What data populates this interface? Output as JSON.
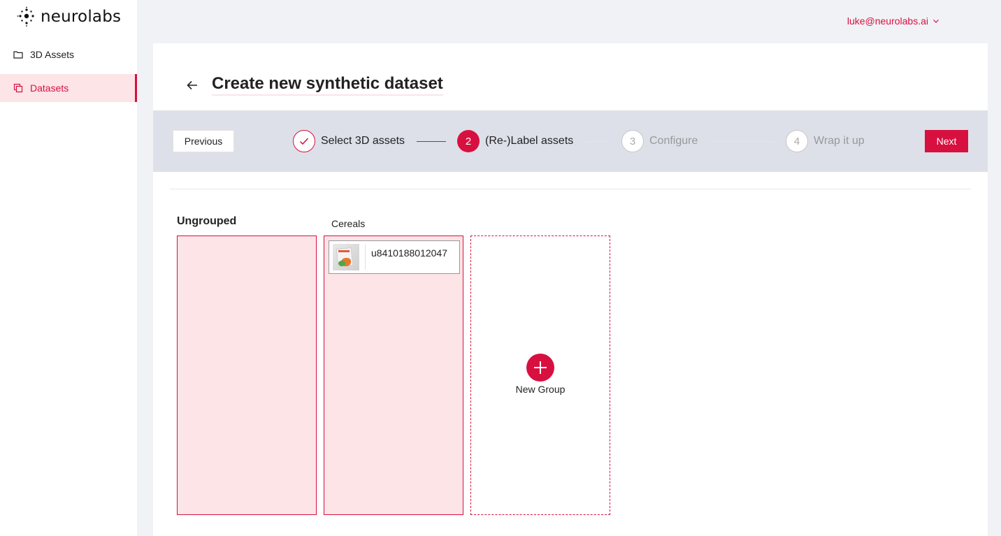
{
  "brand": {
    "name": "neurolabs",
    "accent": "#d8103f"
  },
  "sidebar": {
    "items": [
      {
        "label": "3D Assets",
        "icon": "folder-icon",
        "active": false
      },
      {
        "label": "Datasets",
        "icon": "copy-icon",
        "active": true
      }
    ]
  },
  "header": {
    "user_email": "luke@neurolabs.ai"
  },
  "page": {
    "title": "Create new synthetic dataset"
  },
  "stepper": {
    "previous_label": "Previous",
    "next_label": "Next",
    "steps": [
      {
        "number": "",
        "label": "Select 3D assets",
        "state": "done"
      },
      {
        "number": "2",
        "label": "(Re-)Label assets",
        "state": "current"
      },
      {
        "number": "3",
        "label": "Configure",
        "state": "todo"
      },
      {
        "number": "4",
        "label": "Wrap it up",
        "state": "todo"
      }
    ]
  },
  "groups": {
    "ungrouped_title": "Ungrouped",
    "cereals_title": "Cereals",
    "cereals_items": [
      {
        "name": "u8410188012047"
      }
    ],
    "new_group_label": "New Group"
  }
}
